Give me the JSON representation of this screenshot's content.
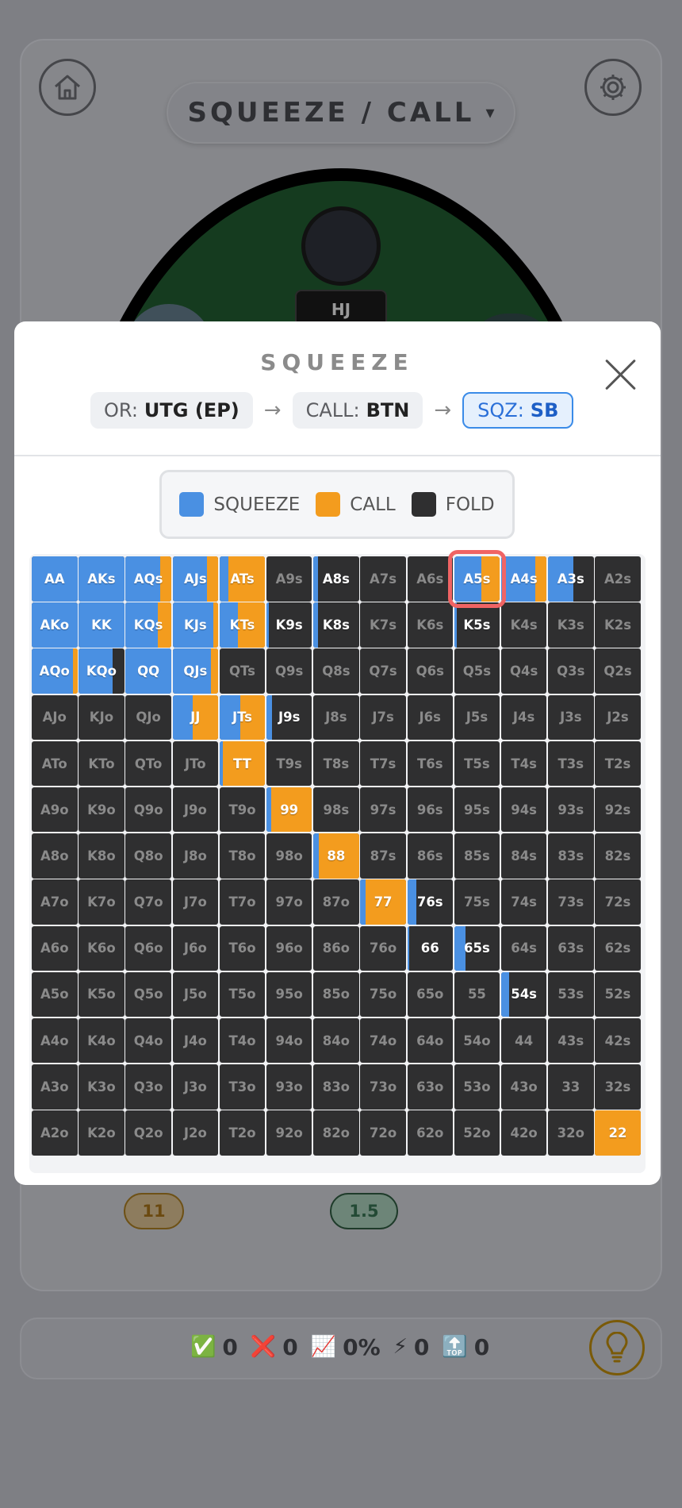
{
  "header": {
    "mode_label": "SQUEEZE / CALL",
    "mode_chevron": "▾",
    "home_icon": "home-icon",
    "settings_icon": "gear-icon"
  },
  "table": {
    "seat_label": "HJ"
  },
  "bets": [
    {
      "value": "11",
      "color": "#f29b1c"
    },
    {
      "value": "1.5",
      "color": "#2a8c55"
    }
  ],
  "stats": [
    {
      "icon": "✅",
      "value": "0"
    },
    {
      "icon": "❌",
      "value": "0"
    },
    {
      "icon": "📈",
      "value": "0%"
    },
    {
      "icon": "⚡",
      "value": "0"
    },
    {
      "icon": "🔝",
      "value": "0"
    }
  ],
  "hint_icon": "lightbulb-icon",
  "modal": {
    "title": "SQUEEZE",
    "close_icon": "close-icon",
    "path": [
      {
        "prefix": "OR:",
        "value": "UTG (EP)"
      },
      {
        "prefix": "CALL:",
        "value": "BTN"
      },
      {
        "prefix": "SQZ:",
        "value": "SB",
        "active": true
      }
    ],
    "arrow": "→",
    "legend": [
      {
        "label": "SQUEEZE",
        "color": "#4a90e2"
      },
      {
        "label": "CALL",
        "color": "#f39c1e"
      },
      {
        "label": "FOLD",
        "color": "#2f2f30"
      }
    ],
    "selected_hand": "A5s",
    "grid": [
      [
        [
          "AA",
          1,
          0
        ],
        [
          "AKs",
          1,
          0
        ],
        [
          "AQs",
          0.75,
          0.25
        ],
        [
          "AJs",
          0.75,
          0.25
        ],
        [
          "ATs",
          0.2,
          0.8
        ],
        [
          "A9s",
          0,
          0
        ],
        [
          "A8s",
          0.1,
          0
        ],
        [
          "A7s",
          0,
          0
        ],
        [
          "A6s",
          0,
          0
        ],
        [
          "A5s",
          0.6,
          0.4
        ],
        [
          "A4s",
          0.75,
          0.25
        ],
        [
          "A3s",
          0.55,
          0
        ],
        [
          "A2s",
          0,
          0
        ]
      ],
      [
        [
          "AKo",
          1,
          0
        ],
        [
          "KK",
          1,
          0
        ],
        [
          "KQs",
          0.7,
          0.3
        ],
        [
          "KJs",
          0.9,
          0.1
        ],
        [
          "KTs",
          0.4,
          0.6
        ],
        [
          "K9s",
          0.05,
          0
        ],
        [
          "K8s",
          0.1,
          0
        ],
        [
          "K7s",
          0,
          0
        ],
        [
          "K6s",
          0,
          0
        ],
        [
          "K5s",
          0.05,
          0
        ],
        [
          "K4s",
          0,
          0
        ],
        [
          "K3s",
          0,
          0
        ],
        [
          "K2s",
          0,
          0
        ]
      ],
      [
        [
          "AQo",
          0.9,
          0.1
        ],
        [
          "KQo",
          0.75,
          0
        ],
        [
          "QQ",
          1,
          0
        ],
        [
          "QJs",
          0.85,
          0.15
        ],
        [
          "QTs",
          0,
          0
        ],
        [
          "Q9s",
          0,
          0
        ],
        [
          "Q8s",
          0,
          0
        ],
        [
          "Q7s",
          0,
          0
        ],
        [
          "Q6s",
          0,
          0
        ],
        [
          "Q5s",
          0,
          0
        ],
        [
          "Q4s",
          0,
          0
        ],
        [
          "Q3s",
          0,
          0
        ],
        [
          "Q2s",
          0,
          0
        ]
      ],
      [
        [
          "AJo",
          0,
          0
        ],
        [
          "KJo",
          0,
          0
        ],
        [
          "QJo",
          0,
          0
        ],
        [
          "JJ",
          0.45,
          0.55
        ],
        [
          "JTs",
          0.45,
          0.55
        ],
        [
          "J9s",
          0.12,
          0
        ],
        [
          "J8s",
          0,
          0
        ],
        [
          "J7s",
          0,
          0
        ],
        [
          "J6s",
          0,
          0
        ],
        [
          "J5s",
          0,
          0
        ],
        [
          "J4s",
          0,
          0
        ],
        [
          "J3s",
          0,
          0
        ],
        [
          "J2s",
          0,
          0
        ]
      ],
      [
        [
          "ATo",
          0,
          0
        ],
        [
          "KTo",
          0,
          0
        ],
        [
          "QTo",
          0,
          0
        ],
        [
          "JTo",
          0,
          0
        ],
        [
          "TT",
          0.08,
          0.92
        ],
        [
          "T9s",
          0,
          0
        ],
        [
          "T8s",
          0,
          0
        ],
        [
          "T7s",
          0,
          0
        ],
        [
          "T6s",
          0,
          0
        ],
        [
          "T5s",
          0,
          0
        ],
        [
          "T4s",
          0,
          0
        ],
        [
          "T3s",
          0,
          0
        ],
        [
          "T2s",
          0,
          0
        ]
      ],
      [
        [
          "A9o",
          0,
          0
        ],
        [
          "K9o",
          0,
          0
        ],
        [
          "Q9o",
          0,
          0
        ],
        [
          "J9o",
          0,
          0
        ],
        [
          "T9o",
          0,
          0
        ],
        [
          "99",
          0.1,
          0.9
        ],
        [
          "98s",
          0,
          0
        ],
        [
          "97s",
          0,
          0
        ],
        [
          "96s",
          0,
          0
        ],
        [
          "95s",
          0,
          0
        ],
        [
          "94s",
          0,
          0
        ],
        [
          "93s",
          0,
          0
        ],
        [
          "92s",
          0,
          0
        ]
      ],
      [
        [
          "A8o",
          0,
          0
        ],
        [
          "K8o",
          0,
          0
        ],
        [
          "Q8o",
          0,
          0
        ],
        [
          "J8o",
          0,
          0
        ],
        [
          "T8o",
          0,
          0
        ],
        [
          "98o",
          0,
          0
        ],
        [
          "88",
          0.12,
          0.88
        ],
        [
          "87s",
          0,
          0
        ],
        [
          "86s",
          0,
          0
        ],
        [
          "85s",
          0,
          0
        ],
        [
          "84s",
          0,
          0
        ],
        [
          "83s",
          0,
          0
        ],
        [
          "82s",
          0,
          0
        ]
      ],
      [
        [
          "A7o",
          0,
          0
        ],
        [
          "K7o",
          0,
          0
        ],
        [
          "Q7o",
          0,
          0
        ],
        [
          "J7o",
          0,
          0
        ],
        [
          "T7o",
          0,
          0
        ],
        [
          "97o",
          0,
          0
        ],
        [
          "87o",
          0,
          0
        ],
        [
          "77",
          0.12,
          0.88
        ],
        [
          "76s",
          0.2,
          0
        ],
        [
          "75s",
          0,
          0
        ],
        [
          "74s",
          0,
          0
        ],
        [
          "73s",
          0,
          0
        ],
        [
          "72s",
          0,
          0
        ]
      ],
      [
        [
          "A6o",
          0,
          0
        ],
        [
          "K6o",
          0,
          0
        ],
        [
          "Q6o",
          0,
          0
        ],
        [
          "J6o",
          0,
          0
        ],
        [
          "T6o",
          0,
          0
        ],
        [
          "96o",
          0,
          0
        ],
        [
          "86o",
          0,
          0
        ],
        [
          "76o",
          0,
          0
        ],
        [
          "66",
          0.05,
          0
        ],
        [
          "65s",
          0.25,
          0
        ],
        [
          "64s",
          0,
          0
        ],
        [
          "63s",
          0,
          0
        ],
        [
          "62s",
          0,
          0
        ]
      ],
      [
        [
          "A5o",
          0,
          0
        ],
        [
          "K5o",
          0,
          0
        ],
        [
          "Q5o",
          0,
          0
        ],
        [
          "J5o",
          0,
          0
        ],
        [
          "T5o",
          0,
          0
        ],
        [
          "95o",
          0,
          0
        ],
        [
          "85o",
          0,
          0
        ],
        [
          "75o",
          0,
          0
        ],
        [
          "65o",
          0,
          0
        ],
        [
          "55",
          0,
          0
        ],
        [
          "54s",
          0.18,
          0
        ],
        [
          "53s",
          0,
          0
        ],
        [
          "52s",
          0,
          0
        ]
      ],
      [
        [
          "A4o",
          0,
          0
        ],
        [
          "K4o",
          0,
          0
        ],
        [
          "Q4o",
          0,
          0
        ],
        [
          "J4o",
          0,
          0
        ],
        [
          "T4o",
          0,
          0
        ],
        [
          "94o",
          0,
          0
        ],
        [
          "84o",
          0,
          0
        ],
        [
          "74o",
          0,
          0
        ],
        [
          "64o",
          0,
          0
        ],
        [
          "54o",
          0,
          0
        ],
        [
          "44",
          0,
          0
        ],
        [
          "43s",
          0,
          0
        ],
        [
          "42s",
          0,
          0
        ]
      ],
      [
        [
          "A3o",
          0,
          0
        ],
        [
          "K3o",
          0,
          0
        ],
        [
          "Q3o",
          0,
          0
        ],
        [
          "J3o",
          0,
          0
        ],
        [
          "T3o",
          0,
          0
        ],
        [
          "93o",
          0,
          0
        ],
        [
          "83o",
          0,
          0
        ],
        [
          "73o",
          0,
          0
        ],
        [
          "63o",
          0,
          0
        ],
        [
          "53o",
          0,
          0
        ],
        [
          "43o",
          0,
          0
        ],
        [
          "33",
          0,
          0
        ],
        [
          "32s",
          0,
          0
        ]
      ],
      [
        [
          "A2o",
          0,
          0
        ],
        [
          "K2o",
          0,
          0
        ],
        [
          "Q2o",
          0,
          0
        ],
        [
          "J2o",
          0,
          0
        ],
        [
          "T2o",
          0,
          0
        ],
        [
          "92o",
          0,
          0
        ],
        [
          "82o",
          0,
          0
        ],
        [
          "72o",
          0,
          0
        ],
        [
          "62o",
          0,
          0
        ],
        [
          "52o",
          0,
          0
        ],
        [
          "42o",
          0,
          0
        ],
        [
          "32o",
          0,
          0
        ],
        [
          "22",
          0,
          1
        ]
      ]
    ]
  }
}
